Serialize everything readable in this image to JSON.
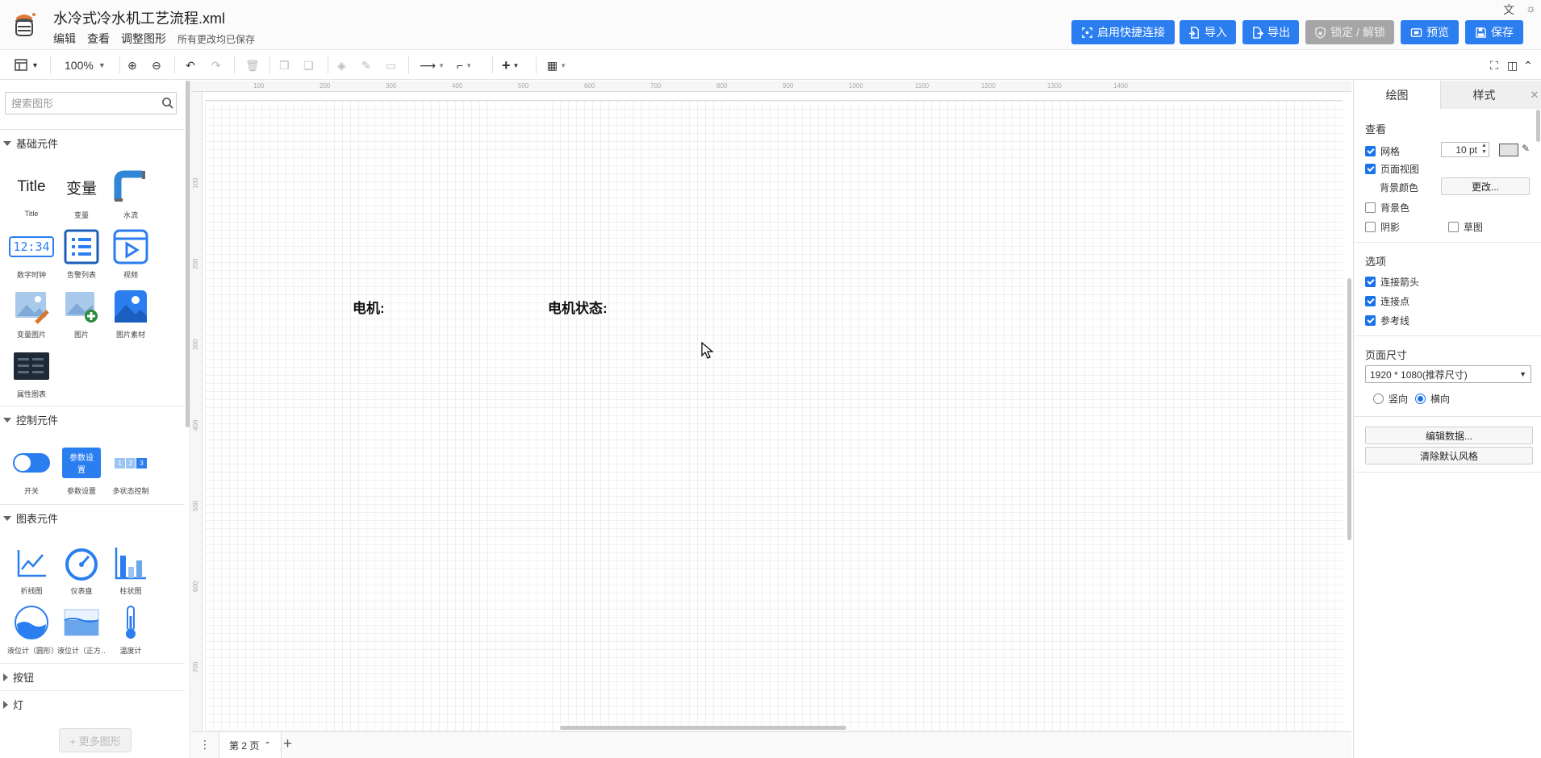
{
  "app": {
    "file_title": "水冷式冷水机工艺流程.xml",
    "menu": [
      "编辑",
      "查看",
      "调整图形"
    ],
    "save_status": "所有更改均已保存"
  },
  "header_buttons": [
    {
      "label": "启用快捷连接",
      "icon": "quick-connect-icon"
    },
    {
      "label": "导入",
      "icon": "import-icon"
    },
    {
      "label": "导出",
      "icon": "export-icon"
    },
    {
      "label": "锁定 / 解锁",
      "icon": "lock-icon",
      "disabled": true
    },
    {
      "label": "预览",
      "icon": "preview-icon"
    },
    {
      "label": "保存",
      "icon": "save-icon"
    }
  ],
  "toolbar": {
    "zoom": "100%"
  },
  "sidebar": {
    "search_placeholder": "搜索图形",
    "sections": {
      "basic": {
        "title": "基础元件",
        "items": [
          "Title",
          "变量",
          "水流",
          "数字时钟",
          "告警列表",
          "视频",
          "变量图片",
          "图片",
          "图片素材",
          "属性图表"
        ]
      },
      "control": {
        "title": "控制元件",
        "items": [
          "开关",
          "参数设置",
          "多状态控制"
        ]
      },
      "chart": {
        "title": "图表元件",
        "items": [
          "折线图",
          "仪表盘",
          "柱状图",
          "液位计（圆形）",
          "液位计（正方…",
          "温度计"
        ]
      },
      "button": {
        "title": "按钮"
      },
      "light": {
        "title": "灯"
      }
    },
    "icon_texts": {
      "title_icon": "Title",
      "var_icon": "变量",
      "clock_icon": "12:34",
      "param_icon": "参数设置",
      "multi_icon": [
        "1",
        "2",
        "3"
      ]
    },
    "more_shapes": "+ 更多图形"
  },
  "ruler": {
    "top": [
      "100",
      "200",
      "300",
      "400",
      "500",
      "600",
      "700",
      "800",
      "900",
      "1000",
      "1100",
      "1200",
      "1300",
      "1400"
    ],
    "left": [
      "100",
      "200",
      "300",
      "400",
      "500",
      "600",
      "700"
    ]
  },
  "canvas": {
    "labels": [
      "电机:",
      "电机状态:"
    ]
  },
  "page_tabs": {
    "current": "第 2 页"
  },
  "right_panel": {
    "tabs": [
      "绘图",
      "样式"
    ],
    "view_header": "查看",
    "grid_label": "网格",
    "grid_size": "10 pt",
    "page_view_label": "页面视图",
    "bg_color_label": "背景颜色",
    "change_button": "更改...",
    "background_label": "背景色",
    "shadow_label": "阴影",
    "sketch_label": "草图",
    "options_header": "选项",
    "connect_arrows": "连接箭头",
    "connect_points": "连接点",
    "guides": "参考线",
    "page_size_header": "页面尺寸",
    "page_size_value": "1920 * 1080(推荐尺寸)",
    "portrait": "竖向",
    "landscape": "横向",
    "edit_data_button": "编辑数据...",
    "clear_style_button": "清除默认风格"
  },
  "colors": {
    "accent": "#2b7ef0",
    "disabled": "#a6a6a6",
    "checkbox": "#1a73e8"
  }
}
